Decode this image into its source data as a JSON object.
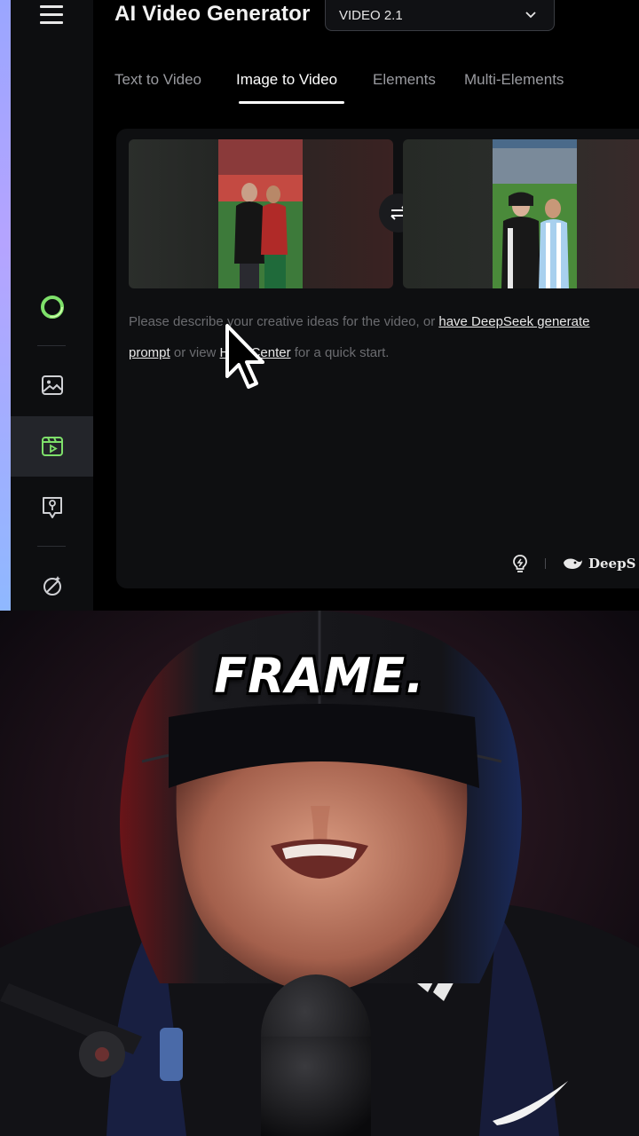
{
  "app": {
    "title": "AI Video Generator",
    "model_select": {
      "value": "VIDEO 2.1"
    }
  },
  "sidebar": {
    "items": [
      {
        "icon": "ring-logo-icon"
      },
      {
        "icon": "image-icon"
      },
      {
        "icon": "video-icon",
        "active": true
      },
      {
        "icon": "shield-pin-icon"
      },
      {
        "icon": "magic-wand-icon"
      }
    ]
  },
  "tabs": [
    {
      "label": "Text to Video"
    },
    {
      "label": "Image to Video",
      "active": true
    },
    {
      "label": "Elements"
    },
    {
      "label": "Multi-Elements"
    }
  ],
  "frames": {
    "start": {
      "label": "start-frame-image"
    },
    "end": {
      "label": "end-frame-image"
    }
  },
  "prompt": {
    "text_1": "Please describe your creative ideas for the video, or ",
    "link_1": "have DeepSeek generate",
    "link_2": "prompt",
    "text_2": " or view ",
    "link_3": "Help Center",
    "text_3": " for a quick start."
  },
  "footer": {
    "deepseek_label": "DeepS"
  },
  "video": {
    "caption": "FRAME."
  },
  "colors": {
    "accent_green": "#7ee06a",
    "background": "#000000",
    "panel": "#0e0f11"
  }
}
